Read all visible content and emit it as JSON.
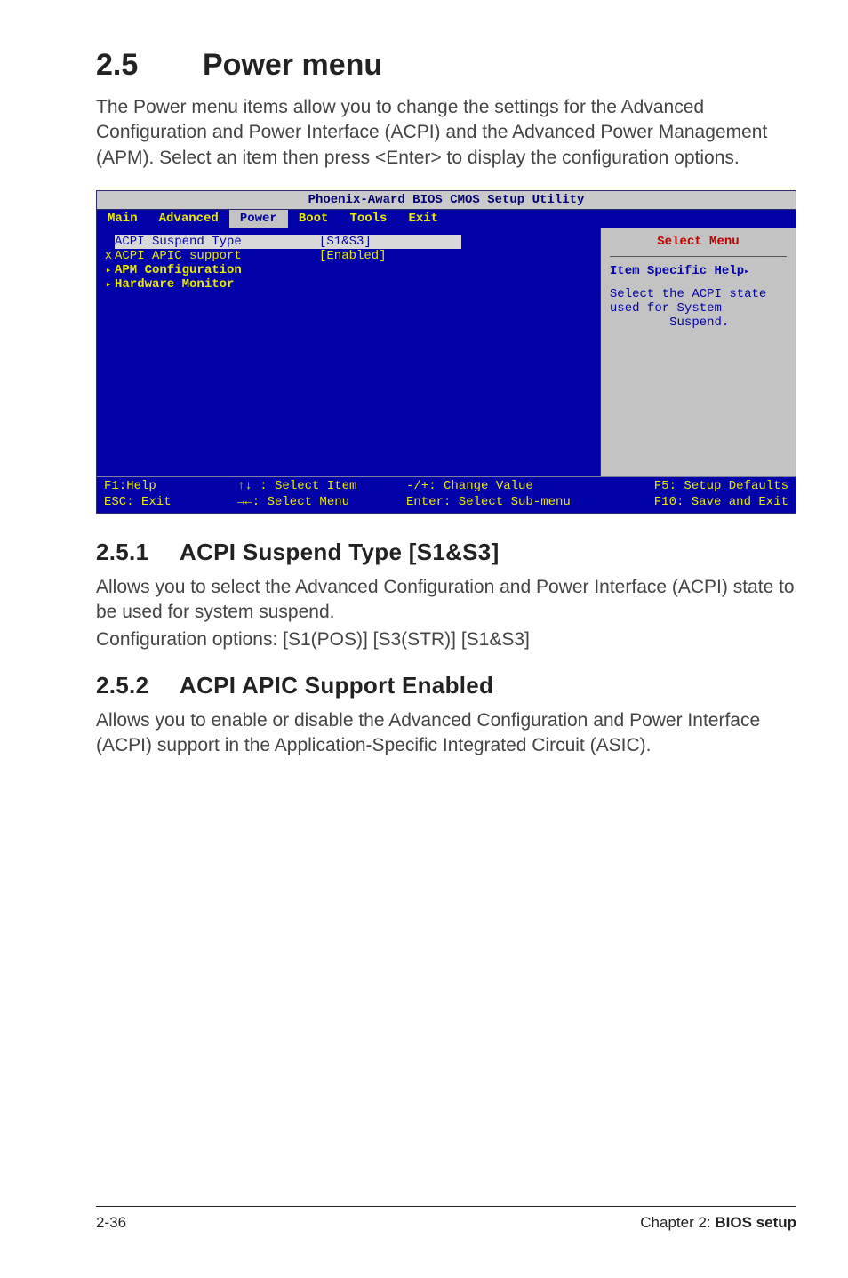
{
  "heading": {
    "number": "2.5",
    "title": "Power menu"
  },
  "intro": "The Power menu items allow you to change the settings for the Advanced Configuration and Power Interface (ACPI) and the Advanced Power Management (APM). Select an item then press <Enter> to display the configuration options.",
  "bios": {
    "title": "Phoenix-Award BIOS CMOS Setup Utility",
    "menu": [
      "Main",
      "Advanced",
      "Power",
      "Boot",
      "Tools",
      "Exit"
    ],
    "active_menu": "Power",
    "rows": [
      {
        "marker": " ",
        "label": "ACPI Suspend Type",
        "value": "[S1&S3]",
        "hl": true
      },
      {
        "marker": "x",
        "label": "ACPI APIC support",
        "value": "[Enabled]",
        "hl": false
      },
      {
        "marker": "▶",
        "label": "APM Configuration",
        "value": "",
        "hl": false
      },
      {
        "marker": "▶",
        "label": "Hardware Monitor",
        "value": "",
        "hl": false
      }
    ],
    "right": {
      "select_menu": "Select Menu",
      "help_label": "Item Specific Help",
      "help_body1": "Select the ACPI state",
      "help_body2": "used for System",
      "help_body3_indent": "        Suspend."
    },
    "foot": {
      "c1a": "F1:Help",
      "c2a": "↑↓ : Select Item",
      "c3a": "-/+: Change Value",
      "c4a": "F5: Setup Defaults",
      "c1b": "ESC: Exit",
      "c2b": "→←: Select Menu",
      "c3b": "Enter: Select Sub-menu",
      "c4b": "F10: Save and Exit"
    }
  },
  "s251": {
    "num": "2.5.1",
    "title": "ACPI Suspend Type [S1&S3]",
    "p1": "Allows you to select the Advanced Configuration and Power Interface (ACPI) state to be used for system suspend.",
    "p2": "Configuration options: [S1(POS)] [S3(STR)] [S1&S3]"
  },
  "s252": {
    "num": "2.5.2",
    "title": "ACPI APIC Support Enabled",
    "p1": "Allows you to enable or disable the Advanced Configuration and Power Interface (ACPI) support in the Application-Specific Integrated Circuit (ASIC)."
  },
  "footer": {
    "left": "2-36",
    "right_prefix": "Chapter 2: ",
    "right_bold": "BIOS setup"
  }
}
